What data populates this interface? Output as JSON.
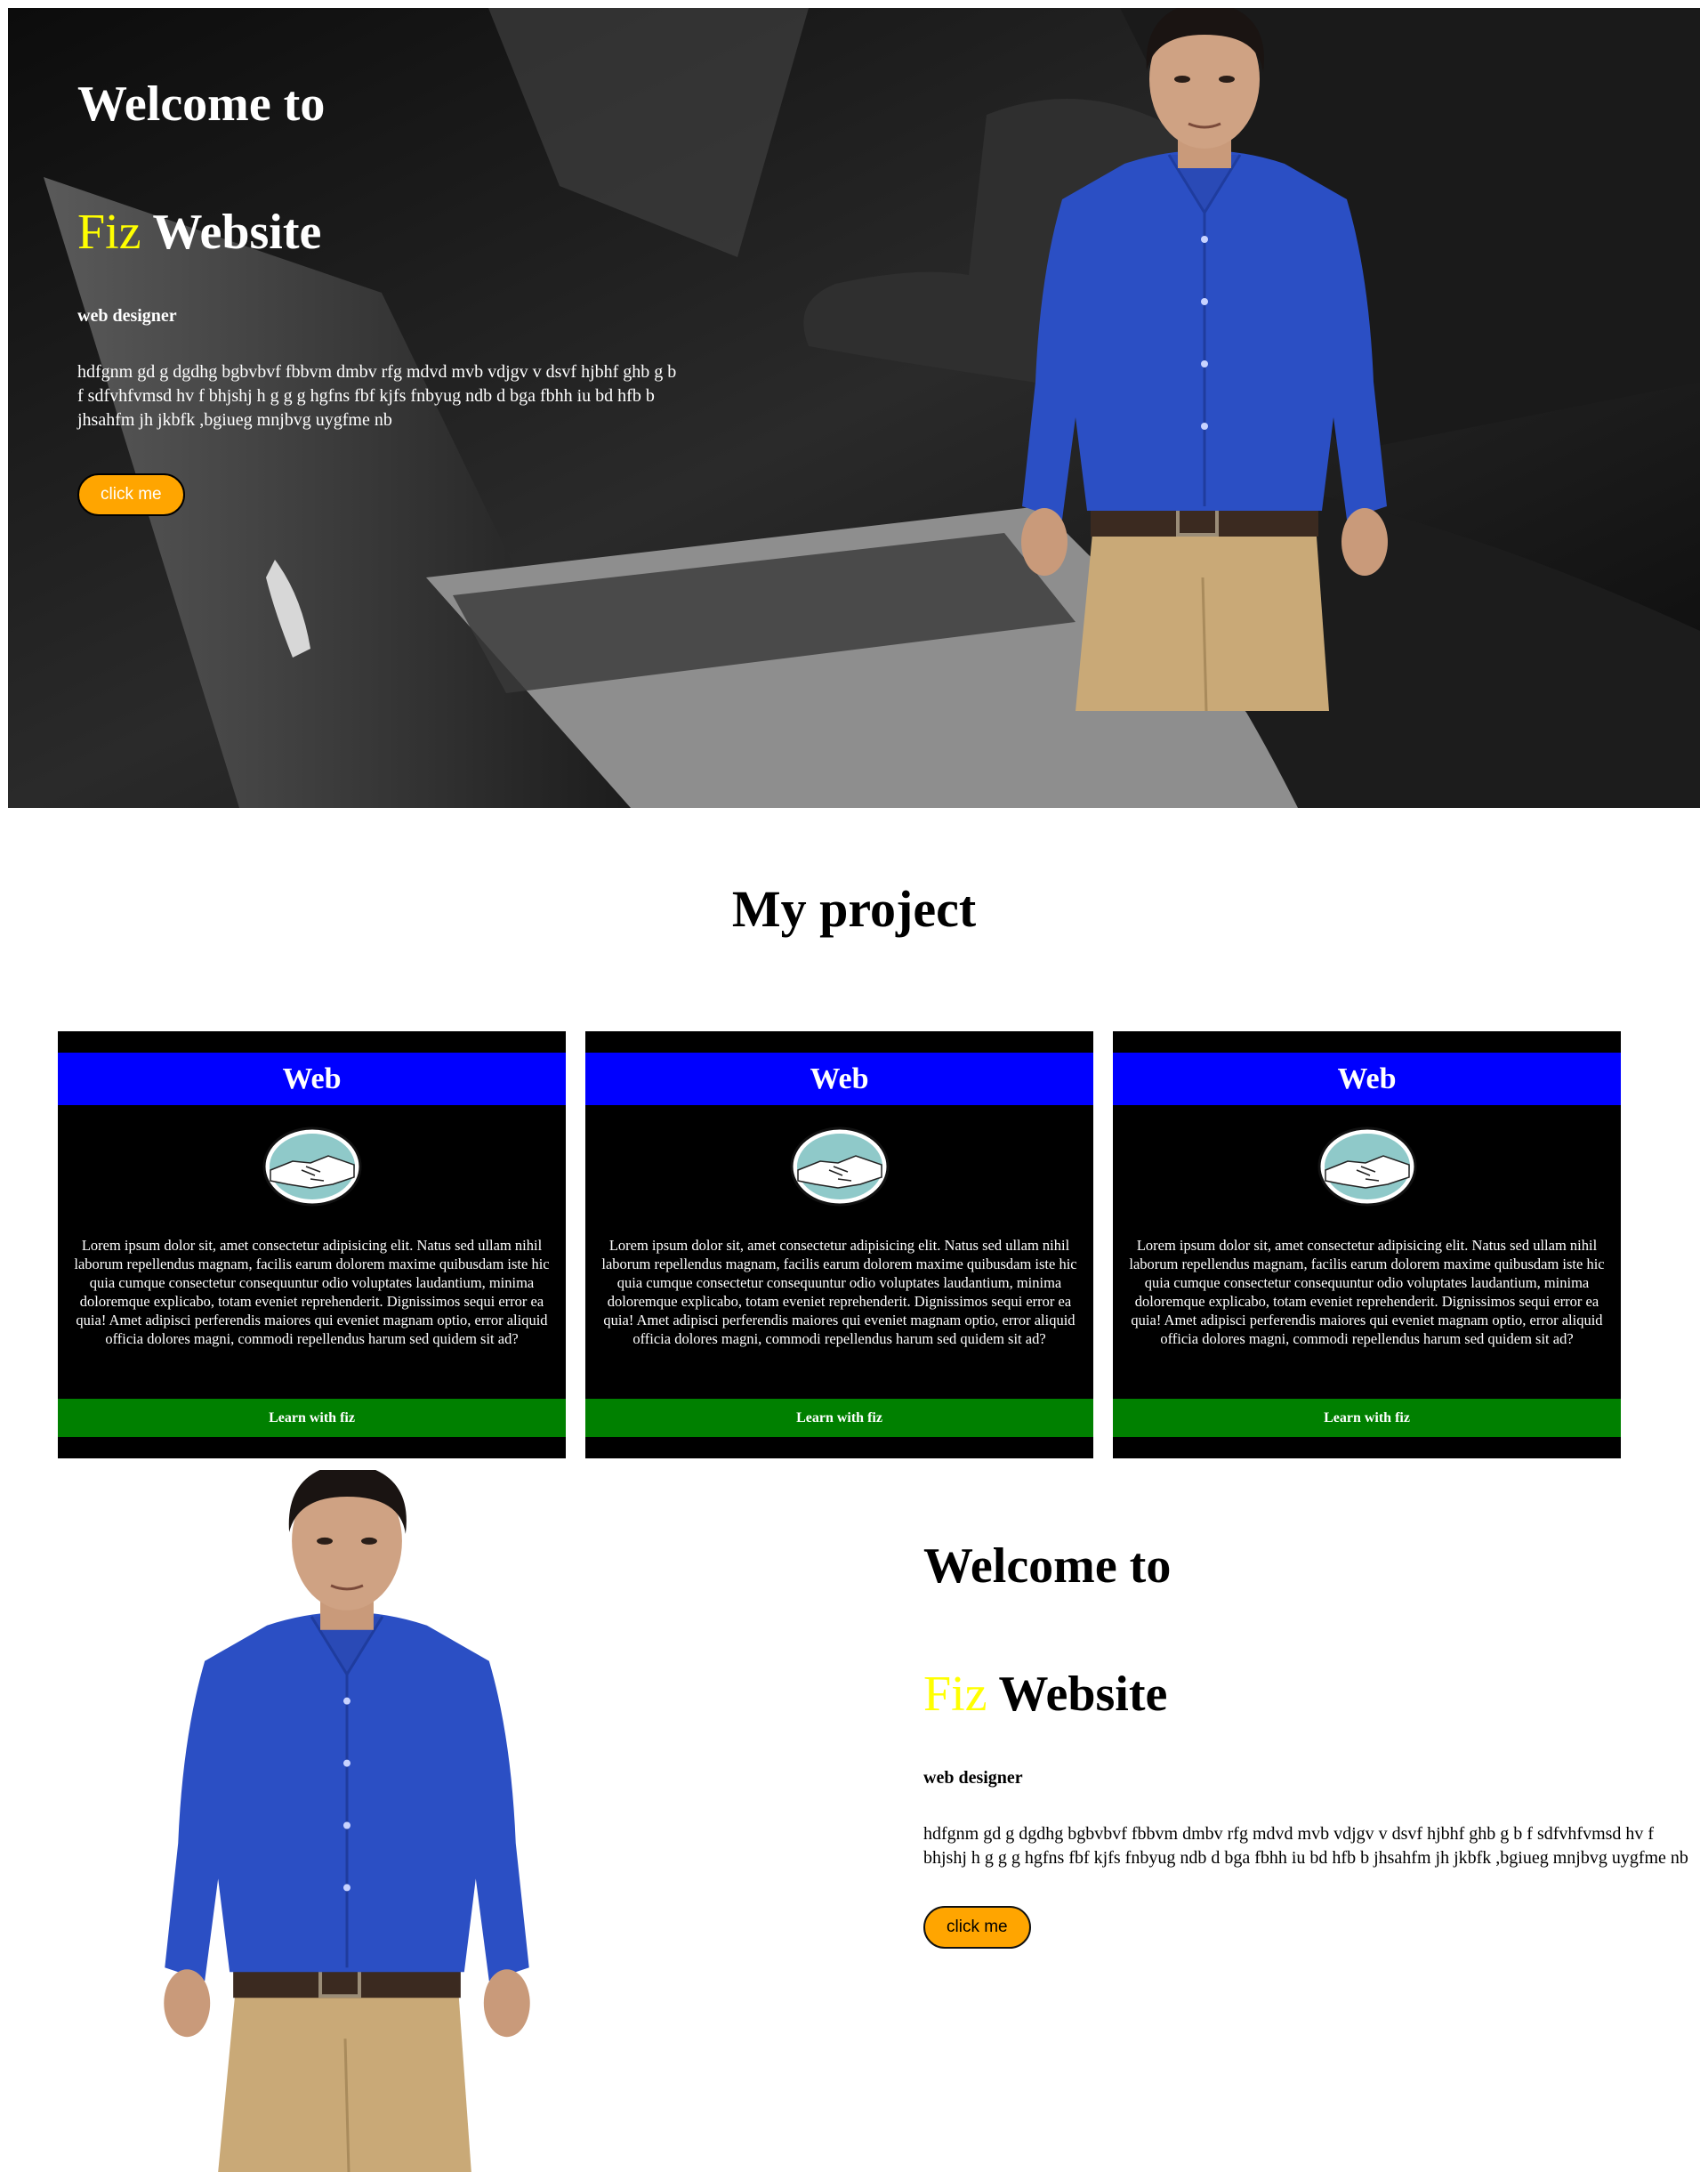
{
  "hero": {
    "title_line1": "Welcome to",
    "title_highlight": "Fiz",
    "title_rest": " Website",
    "role": "web designer",
    "paragraph": "hdfgnm gd g dgdhg bgbvbvf fbbvm dmbv rfg mdvd mvb vdjgv v dsvf hjbhf ghb g b f sdfvhfvmsd hv f bhjshj h g g g hgfns fbf kjfs fnbyug ndb d bga fbhh iu bd hfb b jhsahfm jh jkbfk ,bgiueg mnjbvg uygfme nb",
    "button_label": "click me"
  },
  "projects": {
    "title": "My project",
    "cards": [
      {
        "heading": "Web",
        "icon": "handshake-icon",
        "text": "Lorem ipsum dolor sit, amet consectetur adipisicing elit. Natus sed ullam nihil laborum repellendus magnam, facilis earum dolorem maxime quibusdam iste hic quia cumque consectetur consequuntur odio voluptates laudantium, minima doloremque explicabo, totam eveniet reprehenderit. Dignissimos sequi error ea quia! Amet adipisci perferendis maiores qui eveniet magnam optio, error aliquid officia dolores magni, commodi repellendus harum sed quidem sit ad?",
        "footer": "Learn with fiz"
      },
      {
        "heading": "Web",
        "icon": "handshake-icon",
        "text": "Lorem ipsum dolor sit, amet consectetur adipisicing elit. Natus sed ullam nihil laborum repellendus magnam, facilis earum dolorem maxime quibusdam iste hic quia cumque consectetur consequuntur odio voluptates laudantium, minima doloremque explicabo, totam eveniet reprehenderit. Dignissimos sequi error ea quia! Amet adipisci perferendis maiores qui eveniet magnam optio, error aliquid officia dolores magni, commodi repellendus harum sed quidem sit ad?",
        "footer": "Learn with fiz"
      },
      {
        "heading": "Web",
        "icon": "handshake-icon",
        "text": "Lorem ipsum dolor sit, amet consectetur adipisicing elit. Natus sed ullam nihil laborum repellendus magnam, facilis earum dolorem maxime quibusdam iste hic quia cumque consectetur consequuntur odio voluptates laudantium, minima doloremque explicabo, totam eveniet reprehenderit. Dignissimos sequi error ea quia! Amet adipisci perferendis maiores qui eveniet magnam optio, error aliquid officia dolores magni, commodi repellendus harum sed quidem sit ad?",
        "footer": "Learn with fiz"
      }
    ]
  },
  "about": {
    "title_line1": "Welcome to",
    "title_highlight": "Fiz",
    "title_rest": " Website",
    "role": "web designer",
    "paragraph": "hdfgnm gd g dgdhg bgbvbvf fbbvm dmbv rfg mdvd mvb vdjgv v dsvf hjbhf ghb g b f sdfvhfvmsd hv f bhjshj h g g g hgfns fbf kjfs fnbyug ndb d bga fbhh iu bd hfb b jhsahfm jh jkbfk ,bgiueg mnjbvg uygfme nb",
    "button_label": "click me"
  },
  "colors": {
    "highlight": "#ffff00",
    "button": "#ffa500",
    "card_header": "#0000ff",
    "card_footer": "#008000",
    "shirt": "#2b4fc4",
    "pants": "#c9a977"
  }
}
